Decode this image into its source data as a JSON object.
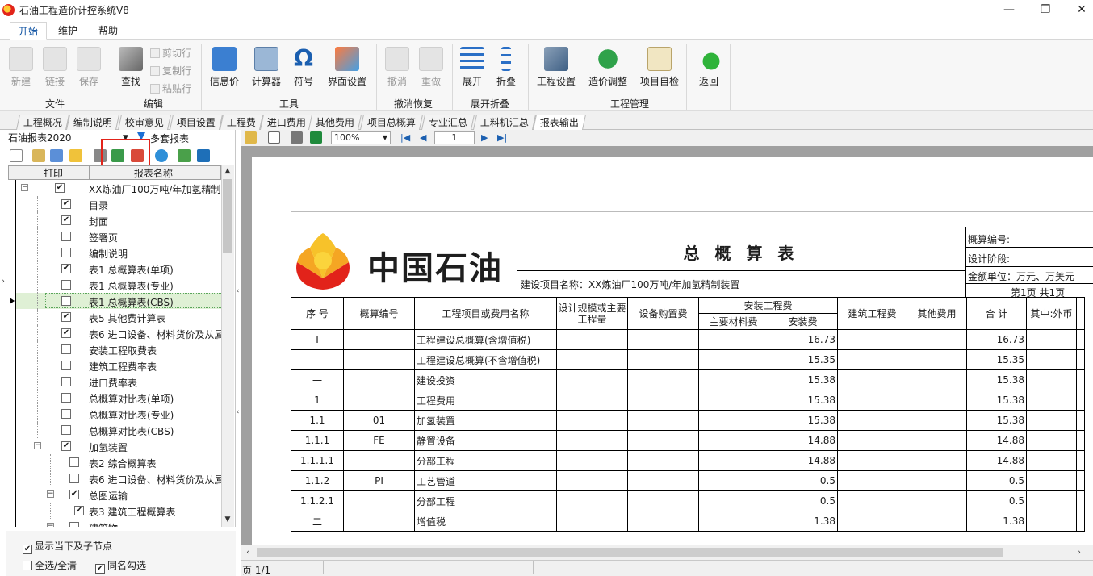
{
  "window": {
    "title": "石油工程造价计控系统V8",
    "min": "—",
    "max": "❐",
    "close": "✕"
  },
  "menu": {
    "tabs": [
      "开始",
      "维护",
      "帮助"
    ]
  },
  "ribbon": {
    "file": {
      "label": "文件",
      "new": "新建",
      "link": "链接",
      "save": "保存"
    },
    "edit": {
      "label": "编辑",
      "find": "查找",
      "cut": "剪切行",
      "copy": "复制行",
      "paste": "粘贴行"
    },
    "tools": {
      "label": "工具",
      "info_price": "信息价",
      "calculator": "计算器",
      "symbol": "符号",
      "symbol_glyph": "Ω",
      "ui_settings": "界面设置"
    },
    "undo": {
      "label": "撤消恢复",
      "undo": "撤消",
      "redo": "重做"
    },
    "expand": {
      "label": "展开折叠",
      "expand": "展开",
      "collapse": "折叠"
    },
    "project": {
      "label": "工程管理",
      "settings": "工程设置",
      "adjust": "造价调整",
      "self_check": "项目自检",
      "back": "返回"
    }
  },
  "section_tabs": [
    "工程概况",
    "编制说明",
    "校审意见",
    "项目设置",
    "工程费",
    "进口费用",
    "其他费用",
    "项目总概算",
    "专业汇总",
    "工料机汇总",
    "报表输出"
  ],
  "left": {
    "report_set": "石油报表2020",
    "plan_label": "多套报表",
    "header_print": "打印",
    "header_name": "报表名称",
    "tree": [
      {
        "label": "XX炼油厂100万吨/年加氢精制",
        "checked": "✔",
        "level": 0,
        "expander": "⊟"
      },
      {
        "label": "目录",
        "checked": "✔",
        "level": 1
      },
      {
        "label": "封面",
        "checked": "✔",
        "level": 1
      },
      {
        "label": "签署页",
        "checked": "",
        "level": 1
      },
      {
        "label": "编制说明",
        "checked": "",
        "level": 1
      },
      {
        "label": "表1 总概算表(单项)",
        "checked": "✔",
        "level": 1
      },
      {
        "label": "表1 总概算表(专业)",
        "checked": "",
        "level": 1
      },
      {
        "label": "表1 总概算表(CBS)",
        "checked": "",
        "level": 1,
        "selected": true
      },
      {
        "label": "表5 其他费计算表",
        "checked": "✔",
        "level": 1
      },
      {
        "label": "表6 进口设备、材料货价及从属",
        "checked": "✔",
        "level": 1
      },
      {
        "label": "安装工程取费表",
        "checked": "",
        "level": 1
      },
      {
        "label": "建筑工程费率表",
        "checked": "",
        "level": 1
      },
      {
        "label": "进口费率表",
        "checked": "",
        "level": 1
      },
      {
        "label": "总概算对比表(单项)",
        "checked": "",
        "level": 1
      },
      {
        "label": "总概算对比表(专业)",
        "checked": "",
        "level": 1
      },
      {
        "label": "总概算对比表(CBS)",
        "checked": "",
        "level": 1
      },
      {
        "label": "加氢装置",
        "checked": "✔",
        "level": 1,
        "expander": "⊟"
      },
      {
        "label": "表2 综合概算表",
        "checked": "",
        "level": 2
      },
      {
        "label": "表6 进口设备、材料货价及从属",
        "checked": "",
        "level": 2
      },
      {
        "label": "总图运输",
        "checked": "✔",
        "level": 2,
        "expander": "⊟"
      },
      {
        "label": "表3 建筑工程概算表",
        "checked": "✔",
        "level": 3
      },
      {
        "label": "建筑物",
        "checked": "",
        "level": 2,
        "expander": "⊟"
      }
    ],
    "opt_show_nodes": "显示当下及子节点",
    "opt_select_all": "全选/全清",
    "opt_same_name": "同名勾选",
    "check_mark": "✔"
  },
  "preview": {
    "zoom": "100%",
    "page": "1",
    "status": "页 1/1",
    "logo_text": "中国石油",
    "title": "总 概 算 表",
    "project_name": "建设项目名称：XX炼油厂100万吨/年加氢精制装置",
    "budget_no": "概算编号:",
    "design_stage": "设计阶段:",
    "unit": "金额单位：万元、万美元",
    "page_info": "第1页  共1页",
    "headers": {
      "seq": "序 号",
      "code": "概算编号",
      "name": "工程项目或费用名称",
      "scale": "设计规模或主要工程量",
      "equip": "设备购置费",
      "install_group": "安装工程费",
      "main_mat": "主要材料费",
      "install": "安装费",
      "build": "建筑工程费",
      "other": "其他费用",
      "total": "合 计",
      "foreign": "其中:外币"
    },
    "rows": [
      {
        "seq": "I",
        "code": "",
        "name": "工程建设总概算(含增值税)",
        "install": "16.73",
        "total": "16.73"
      },
      {
        "seq": "",
        "code": "",
        "name": "工程建设总概算(不含增值税)",
        "install": "15.35",
        "total": "15.35"
      },
      {
        "seq": "一",
        "code": "",
        "name": "建设投资",
        "install": "15.38",
        "total": "15.38"
      },
      {
        "seq": "1",
        "code": "",
        "name": "工程费用",
        "install": "15.38",
        "total": "15.38"
      },
      {
        "seq": "1.1",
        "code": "01",
        "name": "加氢装置",
        "install": "15.38",
        "total": "15.38"
      },
      {
        "seq": "1.1.1",
        "code": "FE",
        "name": "静置设备",
        "install": "14.88",
        "total": "14.88"
      },
      {
        "seq": "1.1.1.1",
        "code": "",
        "name": "分部工程",
        "install": "14.88",
        "total": "14.88"
      },
      {
        "seq": "1.1.2",
        "code": "PI",
        "name": "工艺管道",
        "install": "0.5",
        "total": "0.5"
      },
      {
        "seq": "1.1.2.1",
        "code": "",
        "name": "分部工程",
        "install": "0.5",
        "total": "0.5"
      },
      {
        "seq": "二",
        "code": "",
        "name": "增值税",
        "install": "1.38",
        "total": "1.38"
      }
    ]
  },
  "colors": {
    "accent": "#0a4fa0",
    "highlight": "#e2231a",
    "selected_row": "#dff0d5"
  }
}
